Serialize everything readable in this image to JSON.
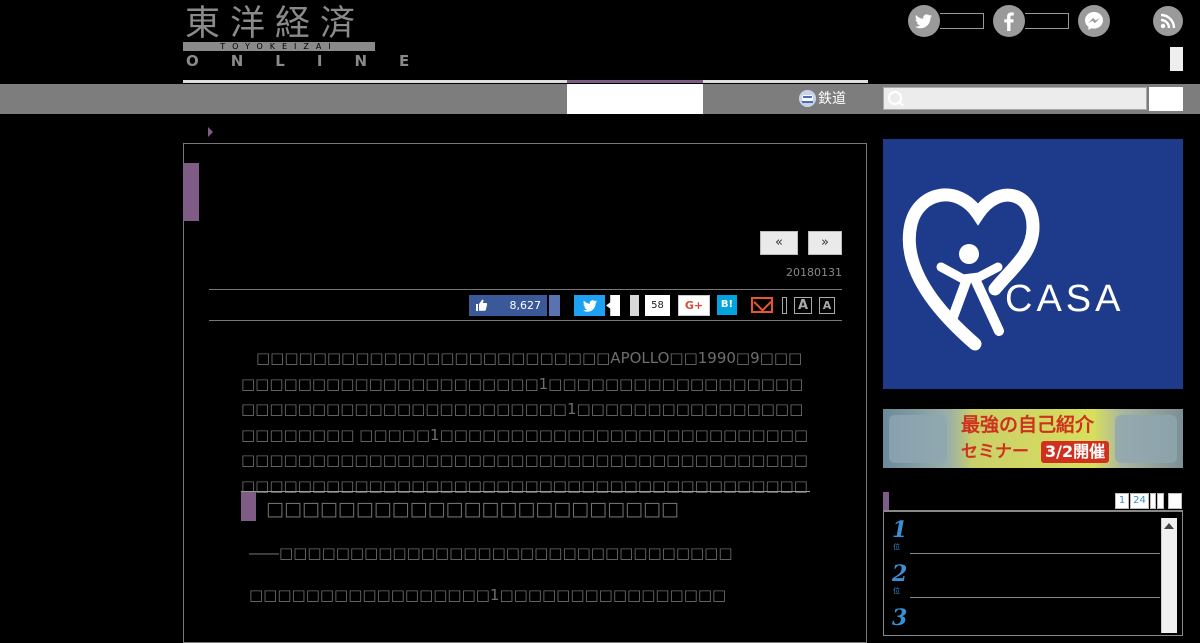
{
  "logo": {
    "kanji": "東洋経済",
    "romaji": "TOYOKEIZAI",
    "online": "ONLINE"
  },
  "social": {
    "twitter_icon": "twitter-icon",
    "facebook_icon": "facebook-icon",
    "messenger_icon": "messenger-icon",
    "rss_icon": "rss-icon"
  },
  "nav": {
    "rail_label": "鉄道",
    "rail_icon": "train-icon",
    "search_placeholder": ""
  },
  "pager": {
    "prev": "«",
    "next": "»"
  },
  "article": {
    "date": "20180131",
    "share": {
      "fb_count": "8,627",
      "hatena_count": "58",
      "gplus": "G+",
      "hatena": "B!",
      "font_large": "A",
      "font_small": "A"
    },
    "paragraphs": [
      "　□□□□□□□□□□□□□□□□□□□□□□□□□APOLLO□□1990□9□□□□□□□□□□□□□□□□□□□□□□□□1□□□□□□□□□□□□□□□□□□□□□□□□□□□□□□□□□□□□□□□□□1□□□□□□□□□□□□□□□□□□□□□□□□ □□□□□1□□□□□□□□□□□□□□□□□□□□□□□□□□□□□□□□□□□□□□□□□□□□□□□□□□□□□□□□□□□□□□□□□□□□□□□□□□□□□□□□□□□□□□□□□□□□□□□□□□□□□□□□□□□"
    ],
    "subheading": "□□□□□□□□□□□□□□□□□□□□□□□",
    "qa": [
      "――□□□□□□□□□□□□□□□□□□□□□□□□□□□□□□□□",
      "□□□□□□□□□□□□□□□□□1□□□□□□□□□□□□□□□□"
    ]
  },
  "sidebar": {
    "casa_ad": {
      "brand": "CASA",
      "registered": "®"
    },
    "seminar_ad": {
      "text1": "最強の自己紹介",
      "text2": "セミナー",
      "text3": "3/2開催"
    },
    "ranking": {
      "tabs": [
        "1",
        "24"
      ],
      "nums": [
        "1",
        "2",
        "3"
      ],
      "suffix": "位"
    }
  },
  "colors": {
    "accent": "#7e5c86",
    "navbar": "#7d7d7d",
    "casa_blue": "#1e3a8a",
    "facebook": "#3b5998",
    "twitter": "#1da1f2"
  }
}
